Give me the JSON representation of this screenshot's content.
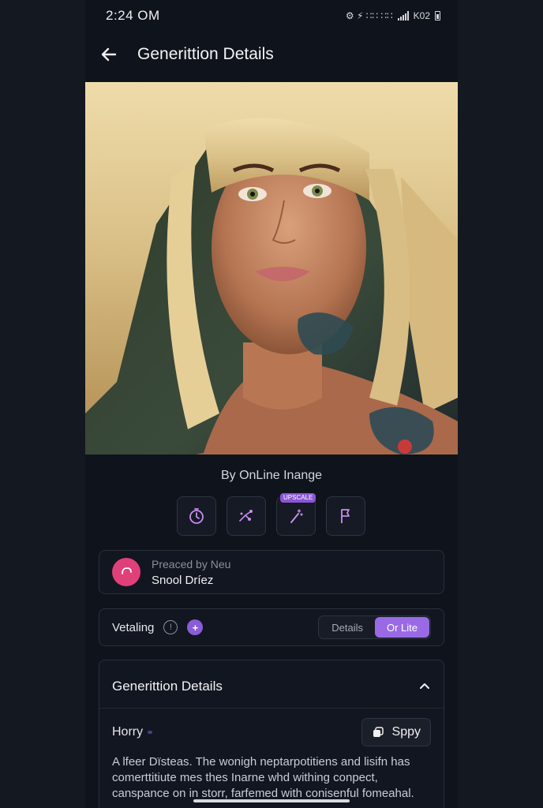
{
  "status_bar": {
    "time": "2:24 OM",
    "icons_text": "⚙ ⚡ ∷∷ ∷∷",
    "network": "K02"
  },
  "header": {
    "title": "Generittion Details"
  },
  "hero": {
    "alt": "Generated portrait image"
  },
  "byline": "By OnLine Inange",
  "tools": [
    {
      "icon": "timer-icon"
    },
    {
      "icon": "sparkle-branch-icon"
    },
    {
      "icon": "wand-icon",
      "badge": "UPSCALE"
    },
    {
      "icon": "flag-icon"
    }
  ],
  "creator": {
    "subtitle": "Preaced by Neu",
    "name": "Snool Dríez"
  },
  "visibility": {
    "label": "Vetaling",
    "info_glyph": "!",
    "plus_glyph": "+",
    "options": [
      "Details",
      "Or Lite"
    ],
    "selected": "Or Lite"
  },
  "details": {
    "title": "Generittion Details",
    "prompt_label": "Horry",
    "copy_label": "Sppy",
    "prompt_text": "A lfeer Dïsteas. The wonigh neptarpotitiens and lisifn has comerttitiute mes thes Inarne whd withing conpect, canspance on in storr, farfemed with conisenful fomeahal."
  },
  "colors": {
    "accent": "#9a6ae6",
    "avatar": "#e0407a",
    "background": "#0f131b"
  }
}
